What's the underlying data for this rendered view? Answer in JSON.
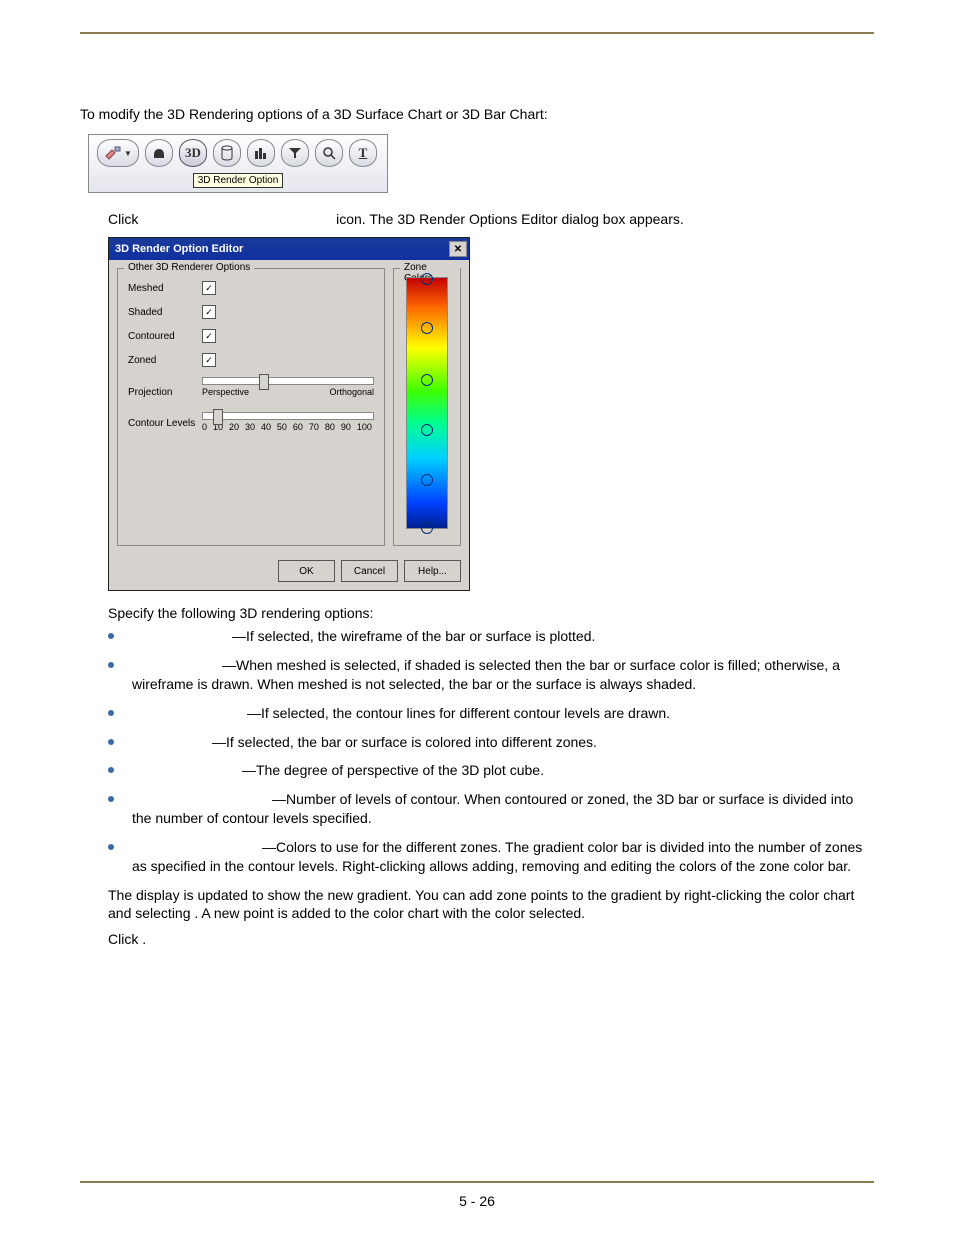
{
  "intro": "To modify the 3D Rendering options of a 3D Surface Chart or 3D Bar Chart:",
  "toolbar": {
    "icons": [
      "paint",
      "▾",
      "hand",
      "3D",
      "cyl",
      "bars",
      "filter",
      "zoom",
      "T"
    ],
    "tooltip": "3D Render Option"
  },
  "step1": {
    "pre": "Click",
    "post": "icon. The 3D Render Options Editor dialog box appears."
  },
  "dialog": {
    "title": "3D Render Option Editor",
    "left_legend": "Other 3D Renderer Options",
    "right_legend": "Zone Colors",
    "rows": {
      "meshed": "Meshed",
      "shaded": "Shaded",
      "contoured": "Contoured",
      "zoned": "Zoned",
      "projection": "Projection",
      "proj_left": "Perspective",
      "proj_right": "Orthogonal",
      "contour_levels": "Contour Levels"
    },
    "scale_ticks": [
      "0",
      "10",
      "20",
      "30",
      "40",
      "50",
      "60",
      "70",
      "80",
      "90",
      "100"
    ],
    "buttons": {
      "ok": "OK",
      "cancel": "Cancel",
      "help": "Help..."
    }
  },
  "specify_heading": "Specify the following 3D rendering options:",
  "bullets": [
    "—If selected, the wireframe of the bar or surface is plotted.",
    "—When meshed is selected, if shaded is selected then the bar or surface color is filled; otherwise, a wireframe is drawn. When meshed is not selected, the bar or the surface is always shaded.",
    "—If selected, the contour lines for different contour levels are drawn.",
    "—If selected, the bar or surface is colored into different zones.",
    "—The degree of perspective of the 3D plot cube.",
    "—Number of levels of contour. When contoured or zoned, the 3D bar or surface is divided into the number of contour levels specified.",
    "—Colors to use for the different zones. The gradient color bar is divided into the number of zones as specified in the contour levels. Right-clicking allows adding, removing and editing the colors of the zone color bar."
  ],
  "bullet_indents": [
    100,
    90,
    115,
    80,
    110,
    140,
    130
  ],
  "post1": "The display is updated to show the new gradient. You can add zone points to the gradient by right-clicking the color chart and selecting      . A new point is added to the color chart with the color selected.",
  "post2": "Click     .",
  "page_num": "5 - 26"
}
